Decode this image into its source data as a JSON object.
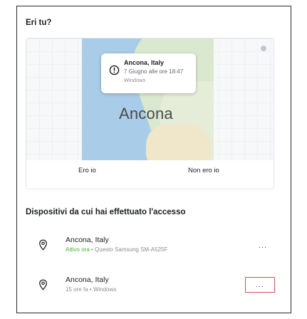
{
  "verify": {
    "title": "Eri tu?",
    "map": {
      "city_label": "Ancona",
      "popup": {
        "location": "Ancona, Italy",
        "time": "7 Giugno alle ore 18:47",
        "device": "Windows"
      }
    },
    "actions": {
      "yes_label": "Ero io",
      "no_label": "Non ero io"
    }
  },
  "devices": {
    "title": "Dispositivi da cui hai effettuato l'accesso",
    "items": [
      {
        "location": "Ancona, Italy",
        "status": "Attivo ora",
        "detail": " • Questo Samsung SM-A525F",
        "more_label": "..."
      },
      {
        "location": "Ancona, Italy",
        "status": "",
        "detail": "15 ore fa • Windows",
        "more_label": "..."
      }
    ]
  },
  "colors": {
    "active_status": "#42b72a",
    "highlight_border": "#d9534f",
    "water": "#a9cde8"
  },
  "icons": [
    "alert-icon",
    "location-pin-icon",
    "info-icon",
    "more-icon"
  ]
}
